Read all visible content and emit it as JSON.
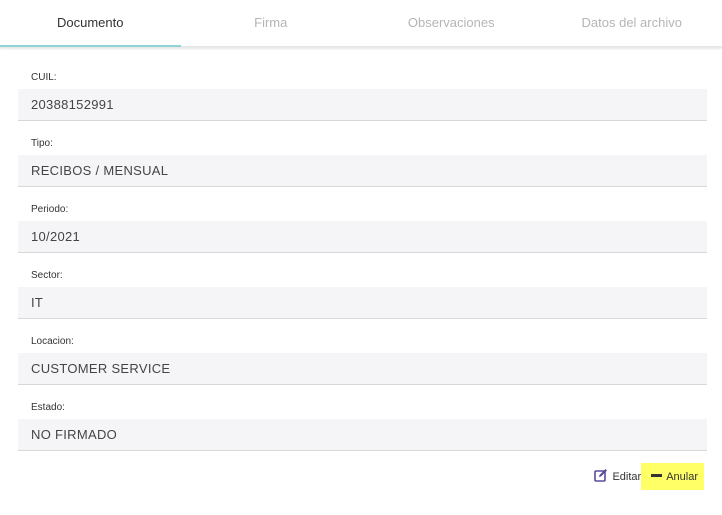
{
  "tabs": [
    {
      "label": "Documento",
      "active": true
    },
    {
      "label": "Firma",
      "active": false
    },
    {
      "label": "Observaciones",
      "active": false
    },
    {
      "label": "Datos del archivo",
      "active": false
    }
  ],
  "fields": [
    {
      "label": "CUIL:",
      "value": "20388152991"
    },
    {
      "label": "Tipo:",
      "value": "RECIBOS / MENSUAL"
    },
    {
      "label": "Periodo:",
      "value": "10/2021"
    },
    {
      "label": "Sector:",
      "value": "IT"
    },
    {
      "label": "Locacion:",
      "value": "CUSTOMER SERVICE"
    },
    {
      "label": "Estado:",
      "value": "NO FIRMADO"
    }
  ],
  "actions": {
    "edit_label": "Editar",
    "edit_icon": "edit-icon",
    "anular_label": "Anular",
    "anular_icon": "minus-icon",
    "anular_highlight": "#ffff66",
    "icon_color": "#5a4a9c"
  },
  "colors": {
    "tab_active_underline": "#8fd3d6",
    "field_bg": "#f5f5f7"
  }
}
